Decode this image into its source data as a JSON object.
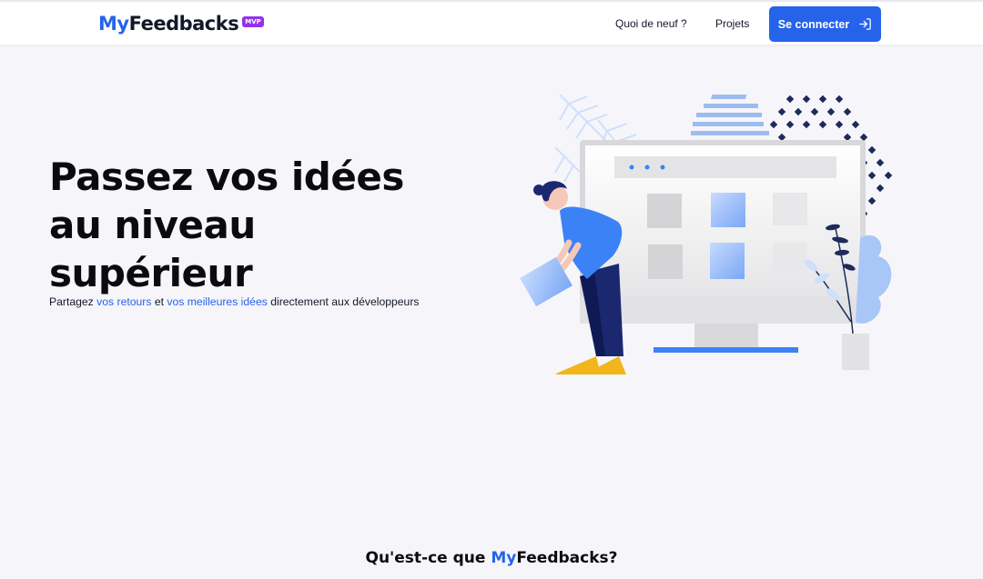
{
  "brand": {
    "logo_my": "My",
    "logo_rest": "Feedbacks",
    "badge": "MVP",
    "accent": "#2563eb",
    "badge_color": "#9333ea"
  },
  "nav": {
    "items": [
      {
        "label": "Quoi de neuf ?"
      },
      {
        "label": "Projets"
      }
    ],
    "login_label": "Se connecter",
    "login_icon": "login-arrow-icon"
  },
  "hero": {
    "title_lines": [
      "Passez vos idées",
      "au niveau",
      "supérieur"
    ],
    "subtitle_parts": [
      "Partagez ",
      "vos retours",
      " et ",
      "vos meilleures idées",
      " directement aux développeurs"
    ]
  },
  "section": {
    "title_prefix": "Qu'est-ce que ",
    "title_brand_my": "My",
    "title_brand_rest": "Feedbacks?"
  }
}
